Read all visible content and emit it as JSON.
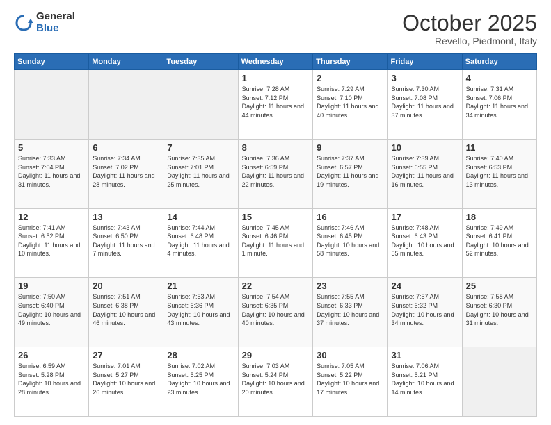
{
  "logo": {
    "general": "General",
    "blue": "Blue"
  },
  "header": {
    "month": "October 2025",
    "location": "Revello, Piedmont, Italy"
  },
  "weekdays": [
    "Sunday",
    "Monday",
    "Tuesday",
    "Wednesday",
    "Thursday",
    "Friday",
    "Saturday"
  ],
  "weeks": [
    [
      {
        "day": "",
        "info": ""
      },
      {
        "day": "",
        "info": ""
      },
      {
        "day": "",
        "info": ""
      },
      {
        "day": "1",
        "info": "Sunrise: 7:28 AM\nSunset: 7:12 PM\nDaylight: 11 hours and 44 minutes."
      },
      {
        "day": "2",
        "info": "Sunrise: 7:29 AM\nSunset: 7:10 PM\nDaylight: 11 hours and 40 minutes."
      },
      {
        "day": "3",
        "info": "Sunrise: 7:30 AM\nSunset: 7:08 PM\nDaylight: 11 hours and 37 minutes."
      },
      {
        "day": "4",
        "info": "Sunrise: 7:31 AM\nSunset: 7:06 PM\nDaylight: 11 hours and 34 minutes."
      }
    ],
    [
      {
        "day": "5",
        "info": "Sunrise: 7:33 AM\nSunset: 7:04 PM\nDaylight: 11 hours and 31 minutes."
      },
      {
        "day": "6",
        "info": "Sunrise: 7:34 AM\nSunset: 7:02 PM\nDaylight: 11 hours and 28 minutes."
      },
      {
        "day": "7",
        "info": "Sunrise: 7:35 AM\nSunset: 7:01 PM\nDaylight: 11 hours and 25 minutes."
      },
      {
        "day": "8",
        "info": "Sunrise: 7:36 AM\nSunset: 6:59 PM\nDaylight: 11 hours and 22 minutes."
      },
      {
        "day": "9",
        "info": "Sunrise: 7:37 AM\nSunset: 6:57 PM\nDaylight: 11 hours and 19 minutes."
      },
      {
        "day": "10",
        "info": "Sunrise: 7:39 AM\nSunset: 6:55 PM\nDaylight: 11 hours and 16 minutes."
      },
      {
        "day": "11",
        "info": "Sunrise: 7:40 AM\nSunset: 6:53 PM\nDaylight: 11 hours and 13 minutes."
      }
    ],
    [
      {
        "day": "12",
        "info": "Sunrise: 7:41 AM\nSunset: 6:52 PM\nDaylight: 11 hours and 10 minutes."
      },
      {
        "day": "13",
        "info": "Sunrise: 7:43 AM\nSunset: 6:50 PM\nDaylight: 11 hours and 7 minutes."
      },
      {
        "day": "14",
        "info": "Sunrise: 7:44 AM\nSunset: 6:48 PM\nDaylight: 11 hours and 4 minutes."
      },
      {
        "day": "15",
        "info": "Sunrise: 7:45 AM\nSunset: 6:46 PM\nDaylight: 11 hours and 1 minute."
      },
      {
        "day": "16",
        "info": "Sunrise: 7:46 AM\nSunset: 6:45 PM\nDaylight: 10 hours and 58 minutes."
      },
      {
        "day": "17",
        "info": "Sunrise: 7:48 AM\nSunset: 6:43 PM\nDaylight: 10 hours and 55 minutes."
      },
      {
        "day": "18",
        "info": "Sunrise: 7:49 AM\nSunset: 6:41 PM\nDaylight: 10 hours and 52 minutes."
      }
    ],
    [
      {
        "day": "19",
        "info": "Sunrise: 7:50 AM\nSunset: 6:40 PM\nDaylight: 10 hours and 49 minutes."
      },
      {
        "day": "20",
        "info": "Sunrise: 7:51 AM\nSunset: 6:38 PM\nDaylight: 10 hours and 46 minutes."
      },
      {
        "day": "21",
        "info": "Sunrise: 7:53 AM\nSunset: 6:36 PM\nDaylight: 10 hours and 43 minutes."
      },
      {
        "day": "22",
        "info": "Sunrise: 7:54 AM\nSunset: 6:35 PM\nDaylight: 10 hours and 40 minutes."
      },
      {
        "day": "23",
        "info": "Sunrise: 7:55 AM\nSunset: 6:33 PM\nDaylight: 10 hours and 37 minutes."
      },
      {
        "day": "24",
        "info": "Sunrise: 7:57 AM\nSunset: 6:32 PM\nDaylight: 10 hours and 34 minutes."
      },
      {
        "day": "25",
        "info": "Sunrise: 7:58 AM\nSunset: 6:30 PM\nDaylight: 10 hours and 31 minutes."
      }
    ],
    [
      {
        "day": "26",
        "info": "Sunrise: 6:59 AM\nSunset: 5:28 PM\nDaylight: 10 hours and 28 minutes."
      },
      {
        "day": "27",
        "info": "Sunrise: 7:01 AM\nSunset: 5:27 PM\nDaylight: 10 hours and 26 minutes."
      },
      {
        "day": "28",
        "info": "Sunrise: 7:02 AM\nSunset: 5:25 PM\nDaylight: 10 hours and 23 minutes."
      },
      {
        "day": "29",
        "info": "Sunrise: 7:03 AM\nSunset: 5:24 PM\nDaylight: 10 hours and 20 minutes."
      },
      {
        "day": "30",
        "info": "Sunrise: 7:05 AM\nSunset: 5:22 PM\nDaylight: 10 hours and 17 minutes."
      },
      {
        "day": "31",
        "info": "Sunrise: 7:06 AM\nSunset: 5:21 PM\nDaylight: 10 hours and 14 minutes."
      },
      {
        "day": "",
        "info": ""
      }
    ]
  ]
}
